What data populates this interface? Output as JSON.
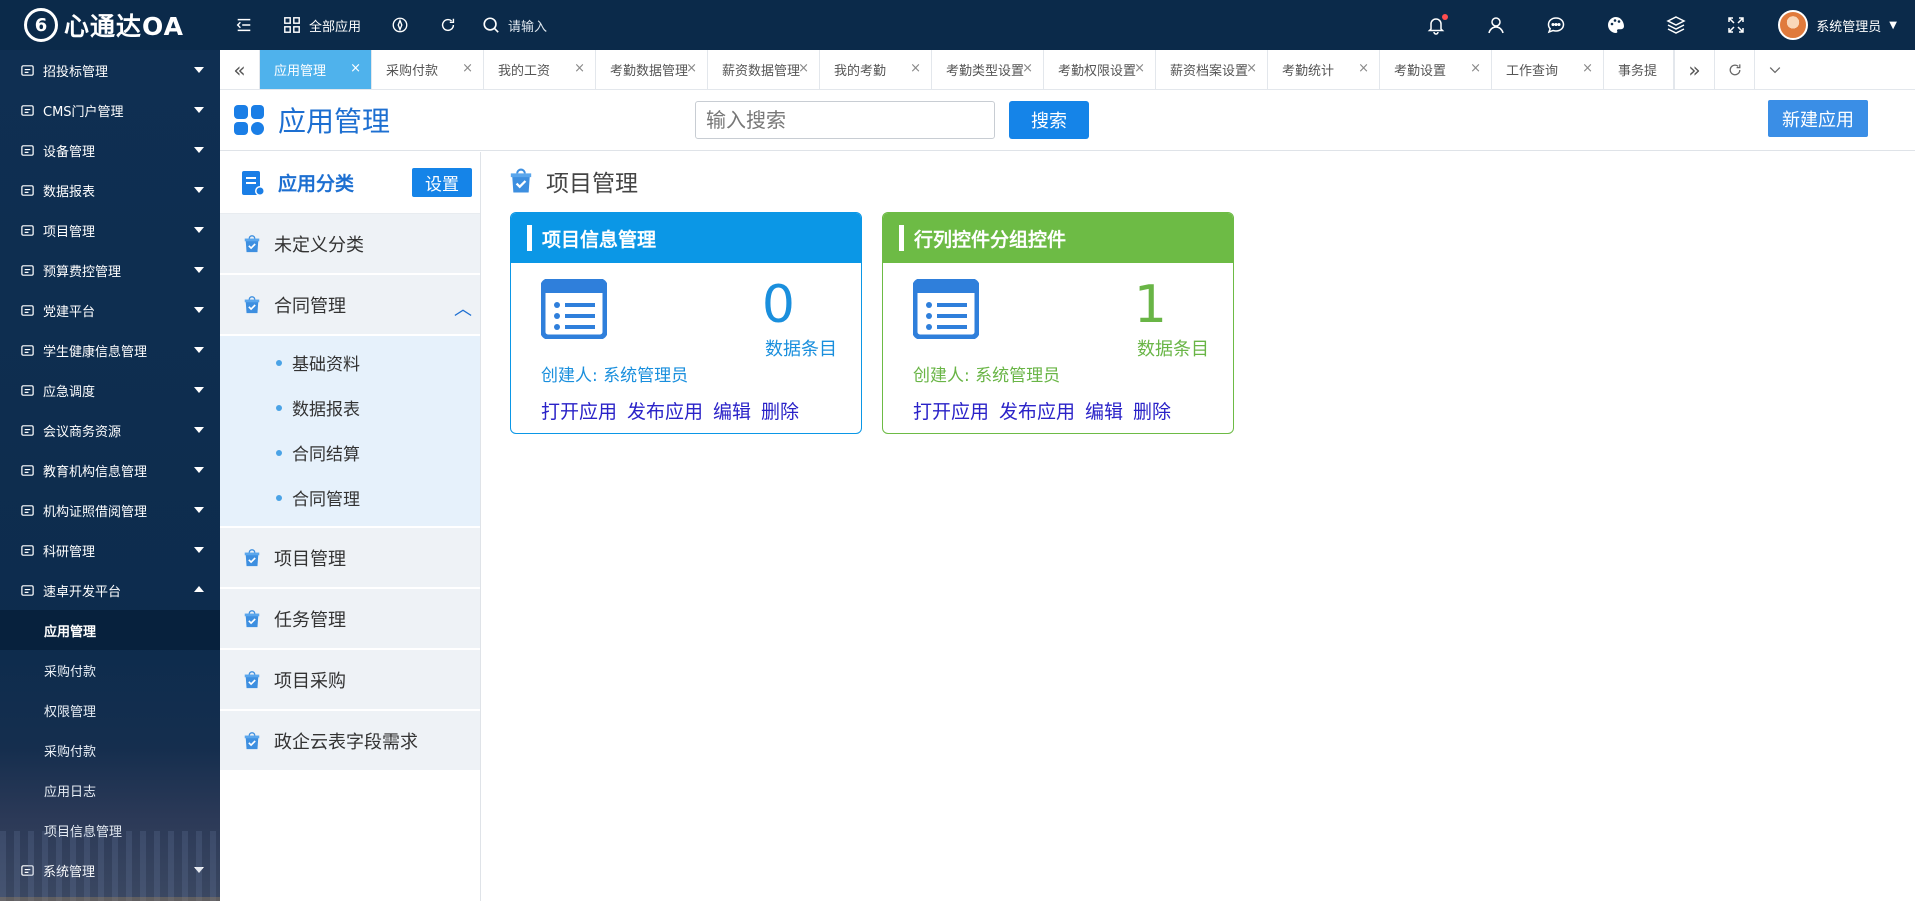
{
  "brand": {
    "mark": "6",
    "name": "心通达OA"
  },
  "topbar": {
    "all_apps": "全部应用",
    "search_placeholder": "请输入",
    "user_name": "系统管理员"
  },
  "sidebar": {
    "items": [
      {
        "label": "招投标管理",
        "icon": "balance-icon"
      },
      {
        "label": "CMS门户管理",
        "icon": "chart-area-icon"
      },
      {
        "label": "设备管理",
        "icon": "monitor-icon"
      },
      {
        "label": "数据报表",
        "icon": "bar-chart-icon"
      },
      {
        "label": "项目管理",
        "icon": "layers-icon"
      },
      {
        "label": "预算费控管理",
        "icon": "money-icon"
      },
      {
        "label": "党建平台",
        "icon": "hammer-icon"
      },
      {
        "label": "学生健康信息管理",
        "icon": "medical-icon"
      },
      {
        "label": "应急调度",
        "icon": "warning-icon"
      },
      {
        "label": "会议商务资源",
        "icon": "people-icon"
      },
      {
        "label": "教育机构信息管理",
        "icon": "graduation-icon"
      },
      {
        "label": "机构证照借阅管理",
        "icon": "id-card-icon"
      },
      {
        "label": "科研管理",
        "icon": "microscope-icon"
      },
      {
        "label": "速卓开发平台",
        "icon": "code-icon"
      }
    ],
    "sub_items": [
      "应用管理",
      "采购付款",
      "权限管理",
      "采购付款",
      "应用日志",
      "项目信息管理"
    ],
    "last_item": "系统管理"
  },
  "tabs": [
    {
      "label": "应用管理",
      "active": true
    },
    {
      "label": "采购付款"
    },
    {
      "label": "我的工资"
    },
    {
      "label": "考勤数据管理"
    },
    {
      "label": "薪资数据管理"
    },
    {
      "label": "我的考勤"
    },
    {
      "label": "考勤类型设置"
    },
    {
      "label": "考勤权限设置"
    },
    {
      "label": "薪资档案设置"
    },
    {
      "label": "考勤统计"
    },
    {
      "label": "考勤设置"
    },
    {
      "label": "工作查询"
    },
    {
      "label": "事务提"
    }
  ],
  "page_header": {
    "title": "应用管理",
    "search_placeholder": "输入搜索",
    "search_button": "搜索",
    "new_button": "新建应用"
  },
  "categories": {
    "title": "应用分类",
    "settings_button": "设置",
    "items": [
      "未定义分类",
      "合同管理"
    ],
    "contract_subs": [
      "基础资料",
      "数据报表",
      "合同结算",
      "合同管理"
    ],
    "items_after": [
      "项目管理",
      "任务管理",
      "项目采购",
      "政企云表字段需求"
    ]
  },
  "main": {
    "section_title": "项目管理",
    "cards": [
      {
        "title": "项目信息管理",
        "count": "0",
        "count_label": "数据条目",
        "creator": "创建人: 系统管理员",
        "color": "#0b97e6"
      },
      {
        "title": "行列控件分组控件",
        "count": "1",
        "count_label": "数据条目",
        "creator": "创建人: 系统管理员",
        "color": "#6dbb45"
      }
    ],
    "actions": [
      "打开应用",
      "发布应用",
      "编辑",
      "删除"
    ]
  }
}
